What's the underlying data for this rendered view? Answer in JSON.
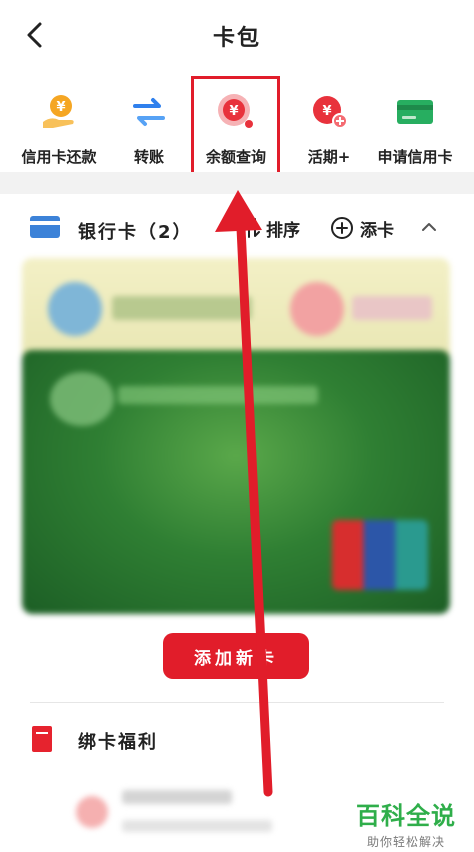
{
  "header": {
    "title": "卡包",
    "back_icon": "chevron-left-icon"
  },
  "quick_actions": [
    {
      "label": "信用卡还款",
      "icon": "hand-coin-icon",
      "color": "#f5a623"
    },
    {
      "label": "转账",
      "icon": "swap-arrows-icon",
      "color": "#2f80ed"
    },
    {
      "label": "余额查询",
      "icon": "yen-search-icon",
      "color": "#e8323c"
    },
    {
      "label": "活期+",
      "icon": "yen-plus-icon",
      "color": "#e8323c"
    },
    {
      "label": "申请信用卡",
      "icon": "credit-card-icon",
      "color": "#27ae60"
    }
  ],
  "cards": {
    "title": "银行卡（2）",
    "sort_label": "排序",
    "add_label": "添卡",
    "collapse_icon": "chevron-up-icon"
  },
  "add_new": {
    "label": "添加新卡"
  },
  "perks": {
    "title": "绑卡福利"
  },
  "watermark": {
    "title": "百科全说",
    "subtitle": "助你轻松解决"
  },
  "colors": {
    "accent": "#e11d2a",
    "brand_green": "#2fae4a"
  }
}
